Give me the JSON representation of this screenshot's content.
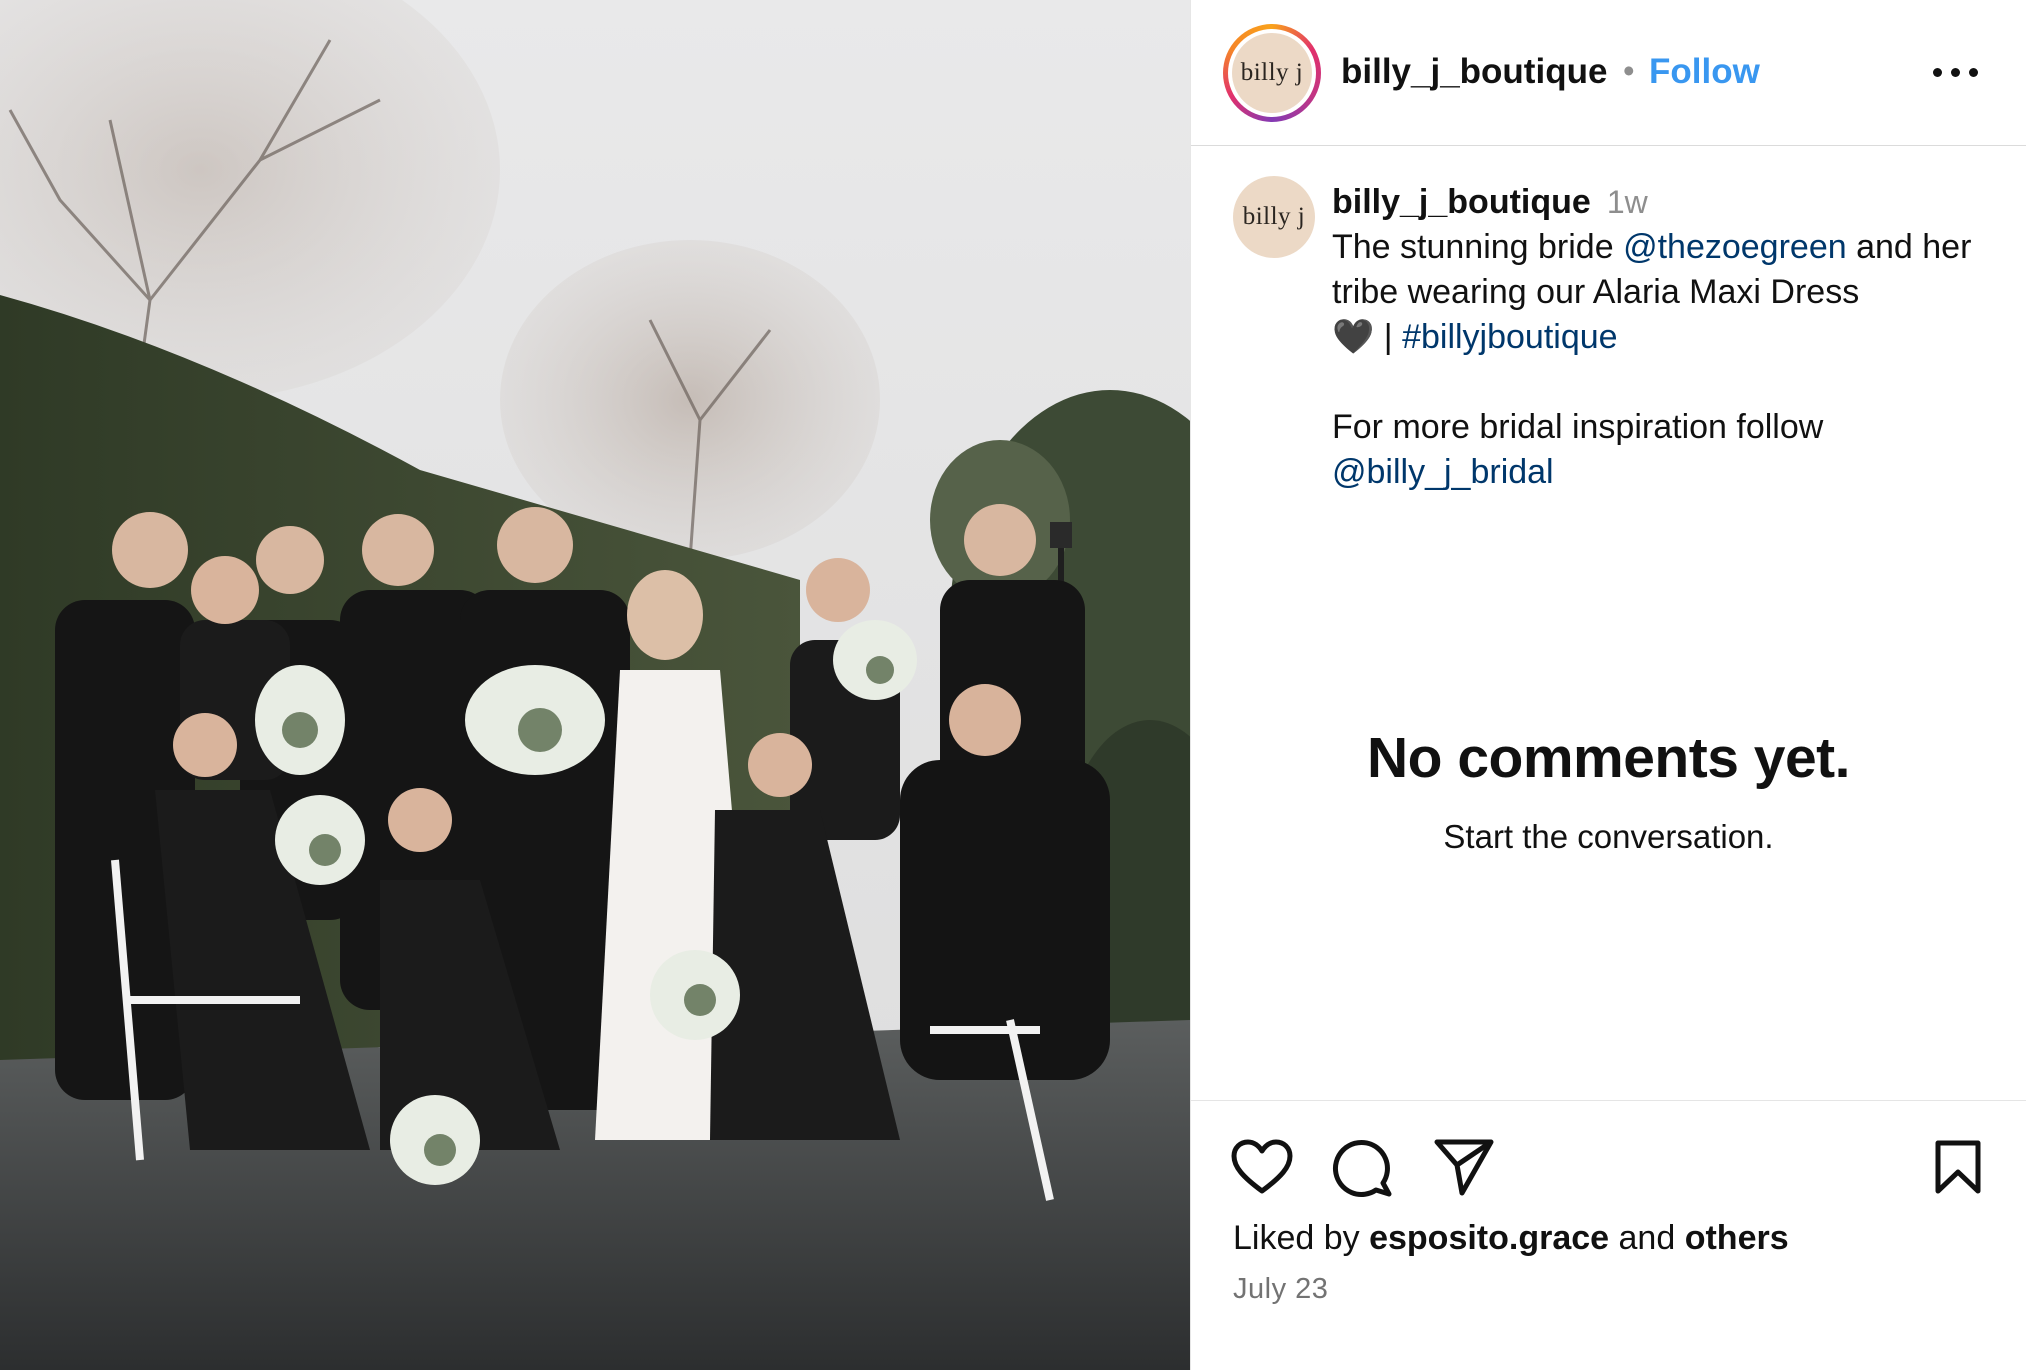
{
  "post": {
    "photo_alt": "Wedding party group portrait",
    "header": {
      "avatar_text": "billy j",
      "username": "billy_j_boutique",
      "separator": "•",
      "follow_label": "Follow"
    },
    "caption": {
      "avatar_text": "billy j",
      "username": "billy_j_boutique",
      "age": "1w",
      "text_1": "The stunning bride ",
      "mention_1": "@thezoegreen",
      "text_2": " and her tribe wearing our Alaria Maxi Dress",
      "emoji": "🖤",
      "text_3": " | ",
      "hashtag": "#billyjboutique",
      "text_4": "For more bridal inspiration follow",
      "mention_2": "@billy_j_bridal"
    },
    "comments": {
      "empty_title": "No comments yet.",
      "empty_subtitle": "Start the conversation."
    },
    "footer": {
      "liked_prefix": "Liked by ",
      "liked_user": "esposito.grace",
      "liked_mid": " and ",
      "liked_others": "others",
      "date": "July 23"
    },
    "icons": [
      "more-horizontal-icon",
      "heart-icon",
      "comment-icon",
      "share-icon",
      "bookmark-icon"
    ],
    "colors": {
      "follow": "#3997f0",
      "link": "#00376b",
      "muted": "#8e8e8e",
      "avatar_bg": "#ecd9c6"
    }
  }
}
